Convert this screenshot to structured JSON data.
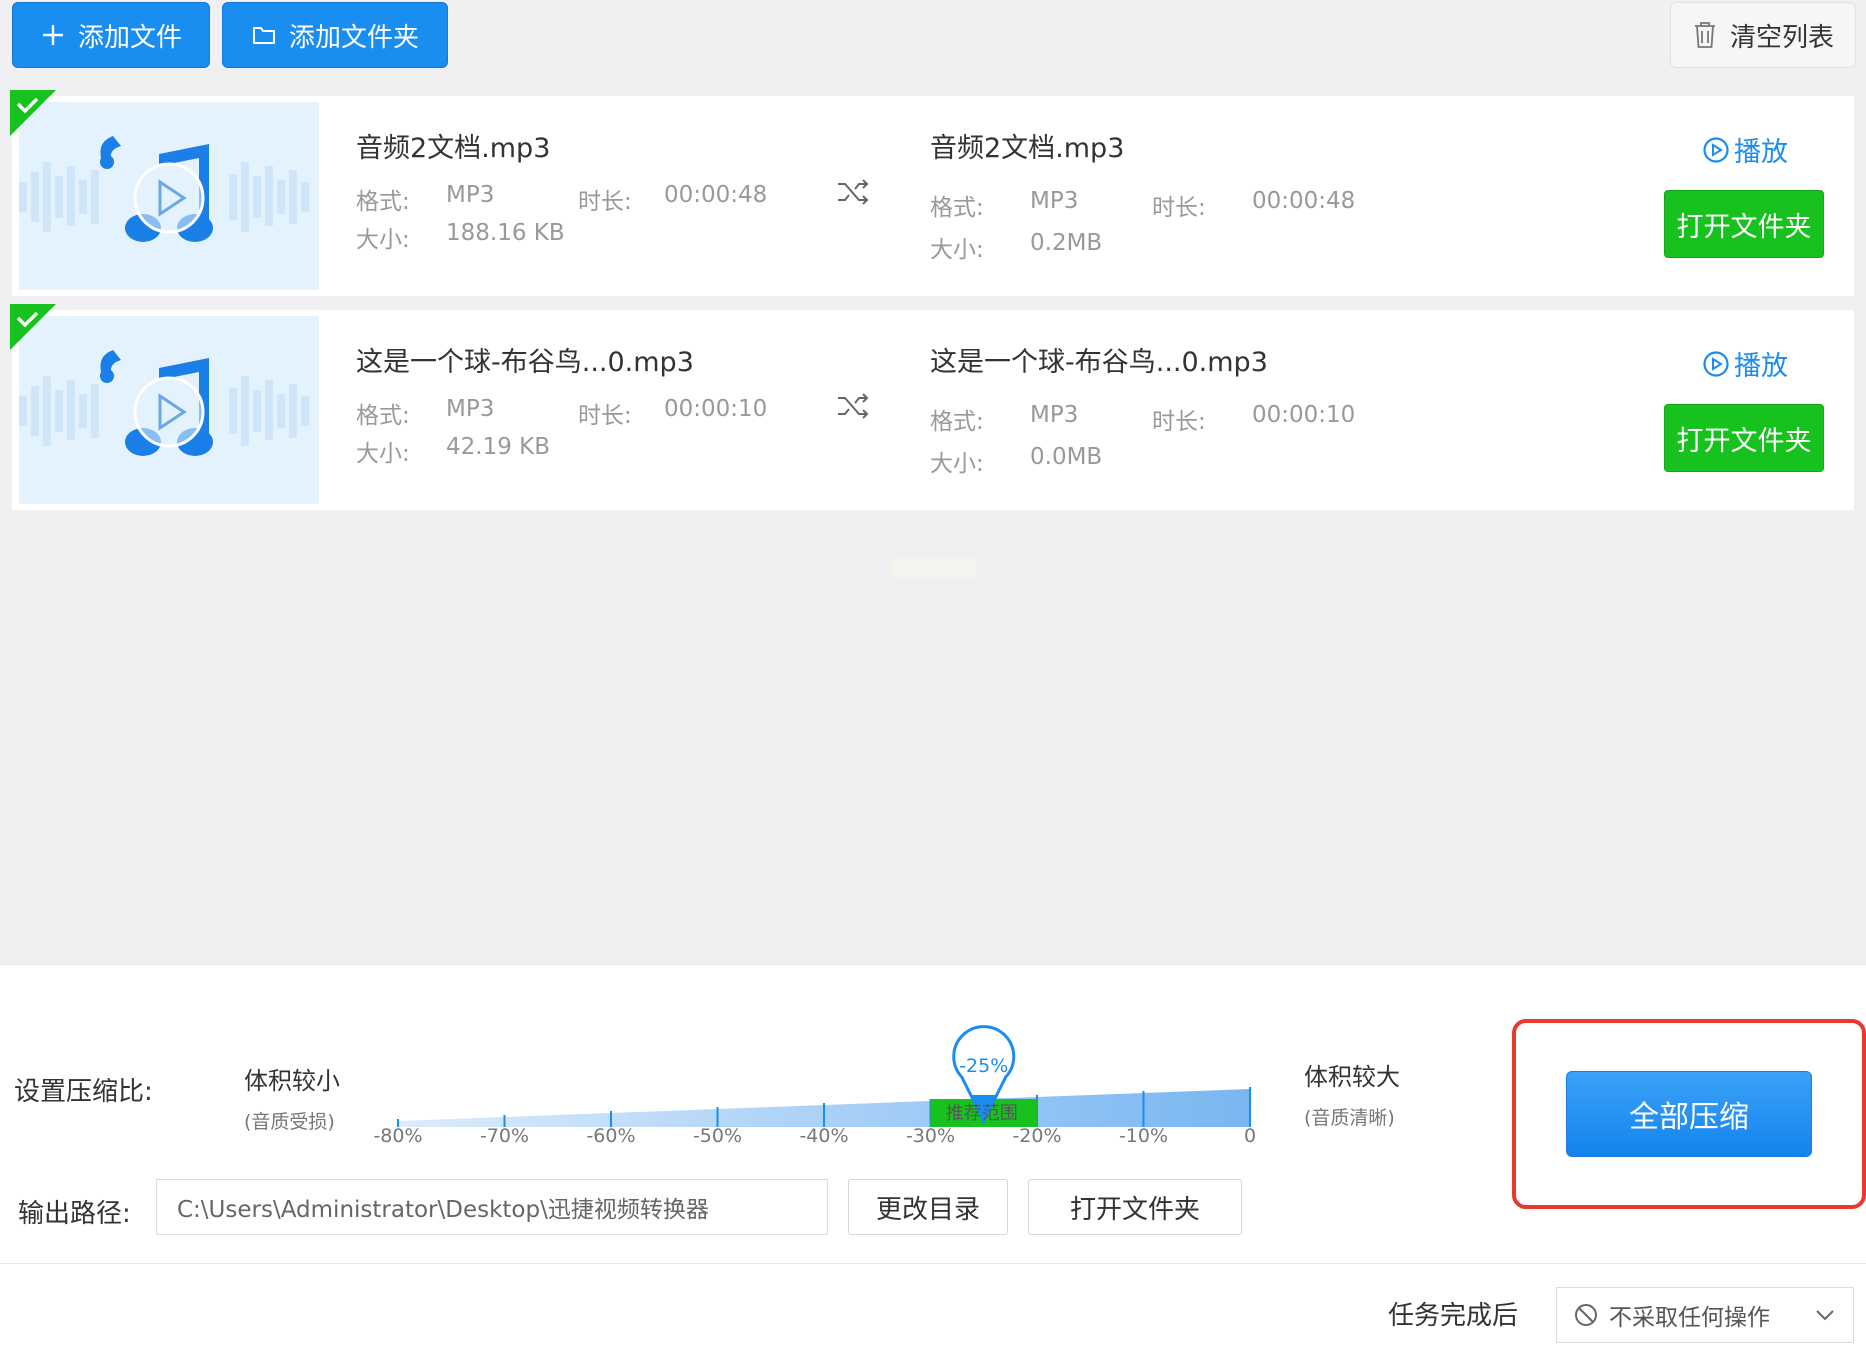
{
  "toolbar": {
    "add_file_label": "添加文件",
    "add_folder_label": "添加文件夹",
    "clear_list_label": "清空列表"
  },
  "files": [
    {
      "source": {
        "name": "音频2文档.mp3",
        "format_key": "格式:",
        "format": "MP3",
        "duration_key": "时长:",
        "duration": "00:00:48",
        "size_key": "大小:",
        "size": "188.16 KB"
      },
      "output": {
        "name": "音频2文档.mp3",
        "format_key": "格式:",
        "format": "MP3",
        "duration_key": "时长:",
        "duration": "00:00:48",
        "size_key": "大小:",
        "size": "0.2MB"
      },
      "play_label": "播放",
      "open_folder_label": "打开文件夹"
    },
    {
      "source": {
        "name": "这是一个球-布谷鸟...0.mp3",
        "format_key": "格式:",
        "format": "MP3",
        "duration_key": "时长:",
        "duration": "00:00:10",
        "size_key": "大小:",
        "size": "42.19 KB"
      },
      "output": {
        "name": "这是一个球-布谷鸟...0.mp3",
        "format_key": "格式:",
        "format": "MP3",
        "duration_key": "时长:",
        "duration": "00:00:10",
        "size_key": "大小:",
        "size": "0.0MB"
      },
      "play_label": "播放",
      "open_folder_label": "打开文件夹"
    }
  ],
  "compression": {
    "label": "设置压缩比:",
    "left_title": "体积较小",
    "left_sub": "(音质受损)",
    "right_title": "体积较大",
    "right_sub": "(音质清晰)",
    "ticks": [
      "-80%",
      "-70%",
      "-60%",
      "-50%",
      "-40%",
      "-30%",
      "-20%",
      "-10%",
      "0"
    ],
    "value_label": "-25%",
    "value": -25,
    "recommended_label": "推荐范围",
    "recommended_range": [
      -30,
      -20
    ]
  },
  "output": {
    "label": "输出路径:",
    "path": "C:\\Users\\Administrator\\Desktop\\迅捷视频转换器",
    "change_dir_label": "更改目录",
    "open_folder_label": "打开文件夹"
  },
  "compress_all_label": "全部压缩",
  "after_task": {
    "label": "任务完成后",
    "selected": "不采取任何操作"
  },
  "colors": {
    "primary_blue": "#1a8df0",
    "success_green": "#17c21f",
    "highlight_red": "#e8392b"
  }
}
